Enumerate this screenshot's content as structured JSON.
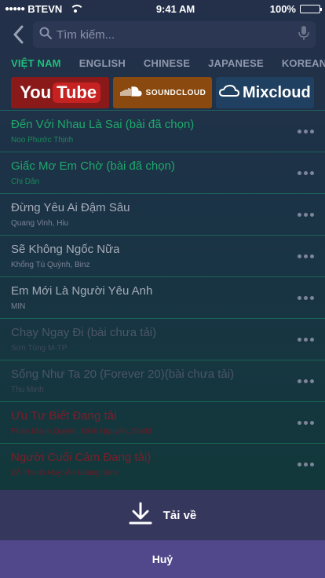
{
  "status_bar": {
    "carrier": "BTEVN",
    "time": "9:41 AM",
    "battery": "100%"
  },
  "search": {
    "placeholder": "Tìm kiếm..."
  },
  "lang_tabs": [
    {
      "label": "VIỆT NAM",
      "active": true
    },
    {
      "label": "ENGLISH",
      "active": false
    },
    {
      "label": "CHINESE",
      "active": false
    },
    {
      "label": "JAPANESE",
      "active": false
    },
    {
      "label": "KOREAN",
      "active": false
    }
  ],
  "sources": {
    "youtube": {
      "label_you": "You",
      "label_tube": "Tube"
    },
    "soundcloud": {
      "label": "SOUNDCLOUD"
    },
    "mixcloud": {
      "label": "Mixcloud"
    }
  },
  "songs": [
    {
      "title": "Đến Với Nhau Là Sai (bài đã chọn)",
      "artist": "Noo Phước Thịnh",
      "state": "selected"
    },
    {
      "title": "Giấc Mơ Em Chờ (bài đã chọn)",
      "artist": "Chi Dân",
      "state": "selected"
    },
    {
      "title": "Đừng Yêu Ai Đậm Sâu",
      "artist": "Quang Vinh, Hiu",
      "state": "normal"
    },
    {
      "title": "Sẽ Không Ngốc Nữa",
      "artist": "Khổng Tú Quỳnh, Binz",
      "state": "normal"
    },
    {
      "title": "Em Mới Là Người Yêu Anh",
      "artist": "MIN",
      "state": "normal"
    },
    {
      "title": "Chạy Ngay Đi (bài chưa tải)",
      "artist": "Sơn Tùng M-TP",
      "state": "dim"
    },
    {
      "title": "Sống Như Ta 20 (Forever 20)(bài chưa tải)",
      "artist": "Thu Minh",
      "state": "dim"
    },
    {
      "title": "Ưu Tư Biết Đang tải",
      "artist": "Phan Mạnh Quỳnh, Minh Nguyên, Sheld",
      "state": "error"
    },
    {
      "title": "Người Cuối Cảm Đang tải)",
      "artist": "Đỗ Thanh Huy, Ân Hoàng Sơn",
      "state": "error"
    }
  ],
  "action_sheet": {
    "download_label": "Tải về",
    "cancel_label": "Huỷ"
  },
  "colors": {
    "accent_green": "#1fbf7b",
    "sheet_download": "#36375c",
    "sheet_cancel": "#51478b"
  }
}
